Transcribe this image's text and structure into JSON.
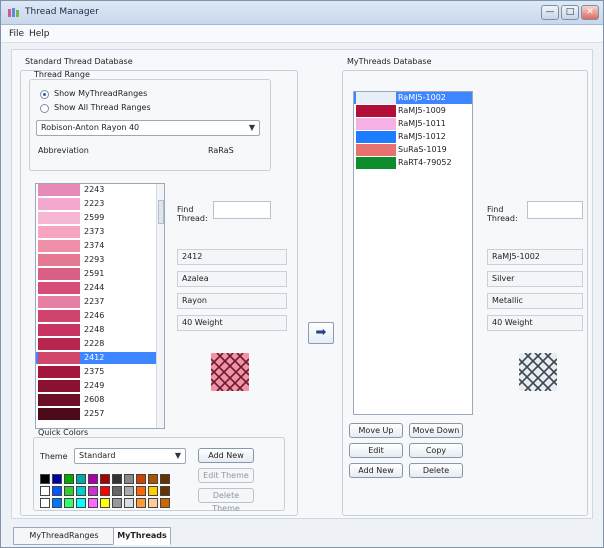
{
  "window": {
    "title": "Thread Manager",
    "controls": [
      "—",
      "□",
      "✕"
    ]
  },
  "menu": [
    "File",
    "Help"
  ],
  "standard": {
    "group_label": "Standard Thread Database",
    "thread_range_label": "Thread Range",
    "radio_my_ranges": "Show MyThreadRanges",
    "radio_all_ranges": "Show All Thread Ranges",
    "selected_range": "Robison-Anton Rayon 40",
    "abbreviation_label": "Abbreviation",
    "abbreviation_value": "RaRaS",
    "find_label": "Find\nThread:",
    "selected_details": [
      "2412",
      "Azalea",
      "Rayon",
      "40 Weight"
    ],
    "threads": [
      {
        "code": "2243",
        "color": "#e58ab6"
      },
      {
        "code": "2223",
        "color": "#f2a8cf"
      },
      {
        "code": "2599",
        "color": "#f8b6d5"
      },
      {
        "code": "2373",
        "color": "#f6a4bf"
      },
      {
        "code": "2374",
        "color": "#ef8fa9"
      },
      {
        "code": "2293",
        "color": "#e47a92"
      },
      {
        "code": "2591",
        "color": "#d95f85"
      },
      {
        "code": "2244",
        "color": "#d84c79"
      },
      {
        "code": "2237",
        "color": "#e57fa3"
      },
      {
        "code": "2246",
        "color": "#d0436d"
      },
      {
        "code": "2248",
        "color": "#c73462"
      },
      {
        "code": "2228",
        "color": "#b7254f"
      },
      {
        "code": "2412",
        "color": "#d1466b",
        "selected": true
      },
      {
        "code": "2375",
        "color": "#a2173d"
      },
      {
        "code": "2249",
        "color": "#8a1130"
      },
      {
        "code": "2608",
        "color": "#6d0f24"
      },
      {
        "code": "2257",
        "color": "#4c0b1a"
      }
    ]
  },
  "quick_colors": {
    "label": "Quick Colors",
    "theme_label": "Theme",
    "theme_value": "Standard",
    "buttons": [
      "Add New",
      "Edit Theme",
      "Delete Theme"
    ],
    "palette": [
      [
        "#000000",
        "#0000aa",
        "#00aa00",
        "#00aaaa",
        "#aa00aa",
        "#aa0000",
        "#333333",
        "#888888",
        "#cc4400",
        "#aa5500",
        "#663300"
      ],
      [
        "#ffffff",
        "#0055ff",
        "#33cc33",
        "#00cccc",
        "#cc33cc",
        "#ff0000",
        "#666666",
        "#aaaaaa",
        "#ff6600",
        "#ffcc00",
        "#663300"
      ],
      [
        "#ffffff",
        "#0077ff",
        "#33ff66",
        "#00ffff",
        "#ff66ff",
        "#ffff00",
        "#999999",
        "#dddddd",
        "#ff9933",
        "#ffcc99",
        "#cc6600"
      ]
    ]
  },
  "mythreads": {
    "group_label": "MyThreads Database",
    "items": [
      {
        "code": "RaMJ5-1002",
        "color": "#e6eef6",
        "selected": true
      },
      {
        "code": "RaMJ5-1009",
        "color": "#b10f37"
      },
      {
        "code": "RaMJ5-1011",
        "color": "#f7b0e6"
      },
      {
        "code": "RaMJ5-1012",
        "color": "#1d7dff"
      },
      {
        "code": "SuRaS-1019",
        "color": "#e9716f"
      },
      {
        "code": "RaRT4-79052",
        "color": "#0d8d2c"
      }
    ],
    "buttons": [
      "Move Up",
      "Move Down",
      "Edit",
      "Copy",
      "Add New",
      "Delete"
    ],
    "find_label": "Find\nThread:",
    "selected_details": [
      "RaMJ5-1002",
      "Silver",
      "Metallic",
      "40 Weight"
    ]
  },
  "tabs": [
    "MyThreadRanges",
    "MyThreads"
  ]
}
